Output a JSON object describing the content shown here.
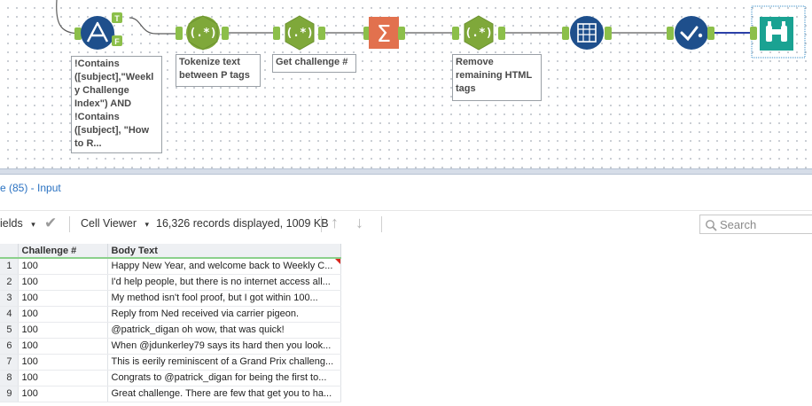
{
  "workflow": {
    "filter_condition": "!Contains\n([subject],\"Weekl\ny Challenge\nIndex\") AND\n!Contains\n([subject], \"How\nto R...",
    "filter_true_anchor": "T",
    "filter_false_anchor": "F",
    "regex_tokenize_label": "Tokenize text\nbetween P tags",
    "regex_challenge_label": "Get challenge #",
    "regex_remove_html_label": "Remove\nremaining HTML\ntags",
    "regex_symbol": "(.*)",
    "summarize_symbol": "Σ"
  },
  "results": {
    "title": "e (85) - Input",
    "fields_label": "ields",
    "viewer_label": "Cell Viewer",
    "records_info": "16,326 records displayed, 1009 KB",
    "search_placeholder": "Search",
    "columns": [
      "Challenge #",
      "Body Text"
    ],
    "rows": [
      {
        "n": "1",
        "challenge": "100",
        "body": "Happy New Year, and welcome back to Weekly C..."
      },
      {
        "n": "2",
        "challenge": "100",
        "body": "I'd help people, but there is no internet access all..."
      },
      {
        "n": "3",
        "challenge": "100",
        "body": "My method isn't fool proof, but I got within 100..."
      },
      {
        "n": "4",
        "challenge": "100",
        "body": "Reply from Ned received via carrier pigeon."
      },
      {
        "n": "5",
        "challenge": "100",
        "body": "@patrick_digan oh wow, that was quick!"
      },
      {
        "n": "6",
        "challenge": "100",
        "body": "When @jdunkerley79 says its hard then you look..."
      },
      {
        "n": "7",
        "challenge": "100",
        "body": "This is eerily reminiscent of a Grand Prix challeng..."
      },
      {
        "n": "8",
        "challenge": "100",
        "body": "Congrats to @patrick_digan for being the first to..."
      },
      {
        "n": "9",
        "challenge": "100",
        "body": "Great challenge. There are few that get you to ha..."
      }
    ]
  },
  "colors": {
    "filter_tool": "#1e4f8c",
    "regex_tool": "#7fa83a",
    "summarize_tool": "#e2714e",
    "browse_tool": "#1aa292",
    "connection": "#5c5c5c",
    "accent_link": "#2a72c2"
  }
}
